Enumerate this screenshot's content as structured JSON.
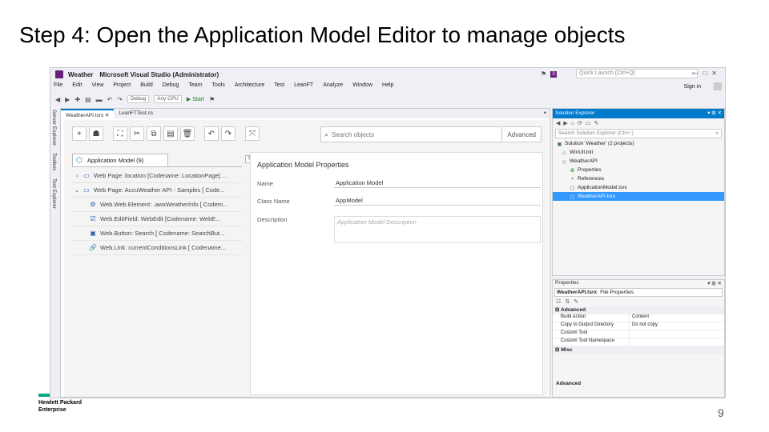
{
  "slide": {
    "title": "Step 4: Open the Application Model Editor to manage objects",
    "page_number": "9",
    "logo": {
      "line1": "Hewlett Packard",
      "line2": "Enterprise",
      "accent": "#01a982"
    }
  },
  "vs": {
    "app_name": "Weather",
    "title": "Microsoft Visual Studio (Administrator)",
    "notification_count": "3",
    "quick_launch_placeholder": "Quick Launch (Ctrl+Q)",
    "sign_in": "Sign in",
    "menu": [
      "File",
      "Edit",
      "View",
      "Project",
      "Build",
      "Debug",
      "Team",
      "Tools",
      "Architecture",
      "Test",
      "LeanFT",
      "Analyze",
      "Window",
      "Help"
    ],
    "toolbar": {
      "config": "Debug",
      "platform": "Any CPU",
      "start": "Start"
    },
    "side_tabs": [
      "Server Explorer",
      "Toolbox",
      "Test Explorer"
    ],
    "doc_tabs": [
      "WeatherAPI.tsrx",
      "LeanFTTest.cs"
    ],
    "accent": "#007acc"
  },
  "editor": {
    "search_placeholder": "Search objects",
    "advanced_label": "Advanced",
    "tree_root": "Application Model (9)",
    "tree": [
      {
        "chev": "›",
        "icon": "window-icon",
        "glyph": "▭",
        "label": "Web Page: location [Codename: LocationPage] ..."
      },
      {
        "chev": "⌄",
        "icon": "window-icon",
        "glyph": "▭",
        "label": "Web Page: AccuWeather API - Samples [ Code..."
      },
      {
        "chev": "",
        "icon": "element-icon",
        "glyph": "⚙",
        "label": "Web.Web.Element: .awxWeatherInfo [ Codem..."
      },
      {
        "chev": "",
        "icon": "editfield-icon",
        "glyph": "☑",
        "label": "Web.EditField: WebEdit [Codename: WebE..."
      },
      {
        "chev": "",
        "icon": "button-icon",
        "glyph": "▣",
        "label": "Web.Button: Search [ Codename: SearchBut..."
      },
      {
        "chev": "",
        "icon": "link-icon",
        "glyph": "🔗",
        "label": "Web.Link: currentConditionsLink [ Codename..."
      }
    ],
    "props_title": "Application Model Properties",
    "name_label": "Name",
    "name_value": "Application Model",
    "class_label": "Class Name",
    "class_value": "AppModel",
    "desc_label": "Description",
    "desc_placeholder": "Application Model Description"
  },
  "solution_explorer": {
    "title": "Solution Explorer",
    "search_placeholder": "Search Solution Explorer (Ctrl+;)",
    "items": [
      {
        "text": "Solution 'Weather' (2 projects)",
        "indent": 0,
        "glyph": "▣",
        "selected": false
      },
      {
        "text": "WinUIUnit",
        "indent": 1,
        "glyph": "◇",
        "selected": false
      },
      {
        "text": "WeatherAPI",
        "indent": 1,
        "glyph": "◇",
        "selected": false
      },
      {
        "text": "Properties",
        "indent": 2,
        "glyph": "⚙",
        "selected": false
      },
      {
        "text": "References",
        "indent": 2,
        "glyph": "▪",
        "selected": false
      },
      {
        "text": "ApplicationModel.tsrx",
        "indent": 2,
        "glyph": "▢",
        "selected": false
      },
      {
        "text": "WeatherAPI.tsrx",
        "indent": 2,
        "glyph": "▢",
        "selected": true
      }
    ]
  },
  "properties": {
    "title": "Properties",
    "file": "WeatherAPI.tsrx",
    "file_kind": "File Properties",
    "category_advanced": "Advanced",
    "category_misc": "Misc",
    "rows": [
      {
        "k": "Build Action",
        "v": "Content"
      },
      {
        "k": "Copy to Output Directory",
        "v": "Do not copy"
      },
      {
        "k": "Custom Tool",
        "v": ""
      },
      {
        "k": "Custom Tool Namespace",
        "v": ""
      }
    ],
    "footer": "Advanced"
  }
}
